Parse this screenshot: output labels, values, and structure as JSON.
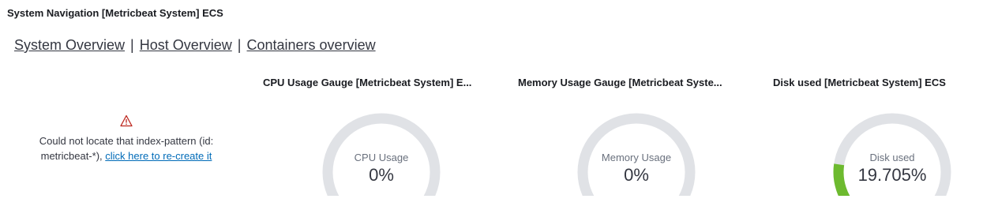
{
  "nav_panel": {
    "title": "System Navigation [Metricbeat System] ECS",
    "links": [
      "System Overview",
      "Host Overview",
      "Containers overview"
    ],
    "separator": "|"
  },
  "error_panel": {
    "icon": "warning-icon",
    "message": "Could not locate that index-pattern (id: metricbeat-*),",
    "link": "click here to re-create it",
    "icon_color": "#bd271e",
    "link_color": "#006bb8"
  },
  "gauges": [
    {
      "title": "CPU Usage Gauge [Metricbeat System] E...",
      "label": "CPU Usage",
      "value_text": "0%",
      "fraction": 0.0
    },
    {
      "title": "Memory Usage Gauge [Metricbeat Syste...",
      "label": "Memory Usage",
      "value_text": "0%",
      "fraction": 0.0
    },
    {
      "title": "Disk used [Metricbeat System] ECS",
      "label": "Disk used",
      "value_text": "19.705%",
      "fraction": 0.19705
    }
  ],
  "colors": {
    "track": "#e0e2e6",
    "fill": "#6dba2f"
  }
}
